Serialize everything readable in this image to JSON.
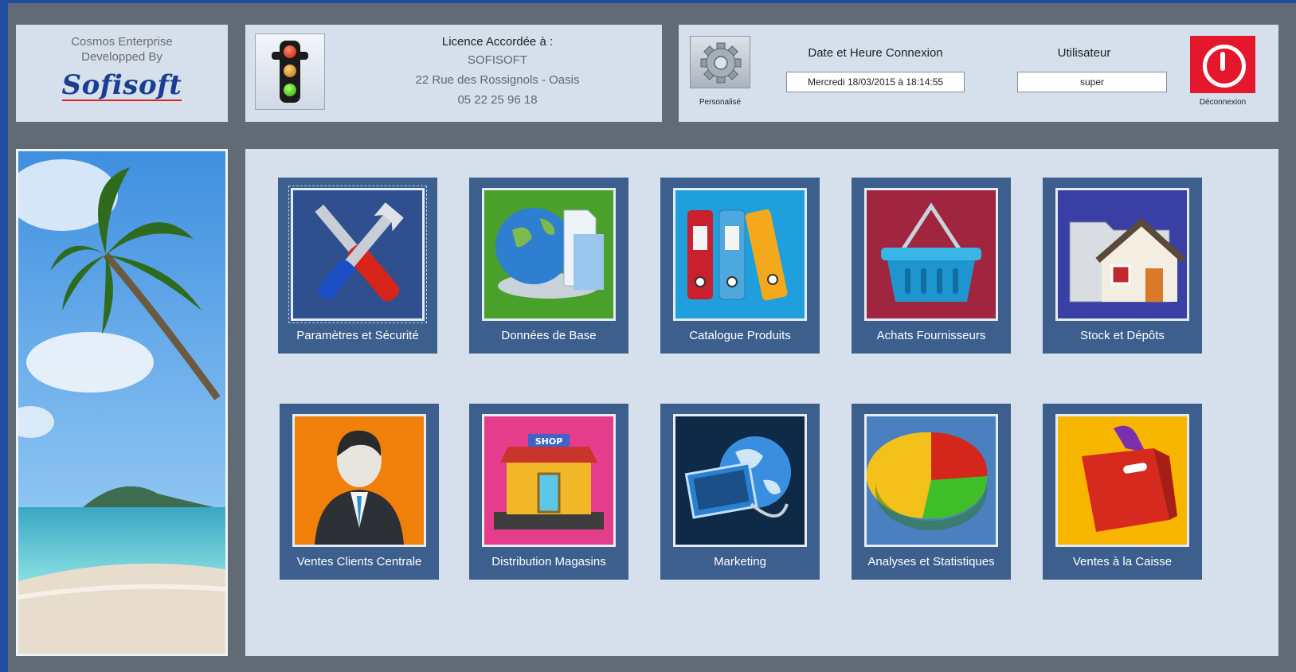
{
  "brand": {
    "line1": "Cosmos Enterprise",
    "line2": "Developped By",
    "logo": "Sofisoft"
  },
  "license": {
    "title": "Licence Accordée à :",
    "company": "SOFISOFT",
    "address": "22 Rue des Rossignols - Oasis",
    "phone": "05 22 25 96 18",
    "status_icon": "traffic-light-icon"
  },
  "session": {
    "custom_label": "Personalisé",
    "datetime_label": "Date et Heure Connexion",
    "datetime_value": "Mercredi  18/03/2015 à 18:14:55",
    "user_label": "Utilisateur",
    "user_value": "super",
    "logout_label": "Déconnexion"
  },
  "modules": [
    {
      "label": "Paramètres et Sécurité",
      "icon": "tools-icon",
      "bg": "#2f4f8f"
    },
    {
      "label": "Données de Base",
      "icon": "globe-folder-icon",
      "bg": "#49a02a"
    },
    {
      "label": "Catalogue Produits",
      "icon": "binders-icon",
      "bg": "#1fa0dc"
    },
    {
      "label": "Achats Fournisseurs",
      "icon": "basket-icon",
      "bg": "#a0263f"
    },
    {
      "label": "Stock et Dépôts",
      "icon": "house-folder-icon",
      "bg": "#3a3fa6"
    },
    {
      "label": "Ventes Clients Centrale",
      "icon": "businessman-icon",
      "bg": "#f0800a"
    },
    {
      "label": "Distribution Magasins",
      "icon": "shop-icon",
      "bg": "#e53d8b"
    },
    {
      "label": "Marketing",
      "icon": "globe-monitor-icon",
      "bg": "#0f2a47"
    },
    {
      "label": "Analyses et Statistiques",
      "icon": "pie-chart-icon",
      "bg": "#4a7fc0"
    },
    {
      "label": "Ventes à la Caisse",
      "icon": "shopping-bag-icon",
      "bg": "#f7b500"
    }
  ],
  "shop_sign": "SHOP"
}
